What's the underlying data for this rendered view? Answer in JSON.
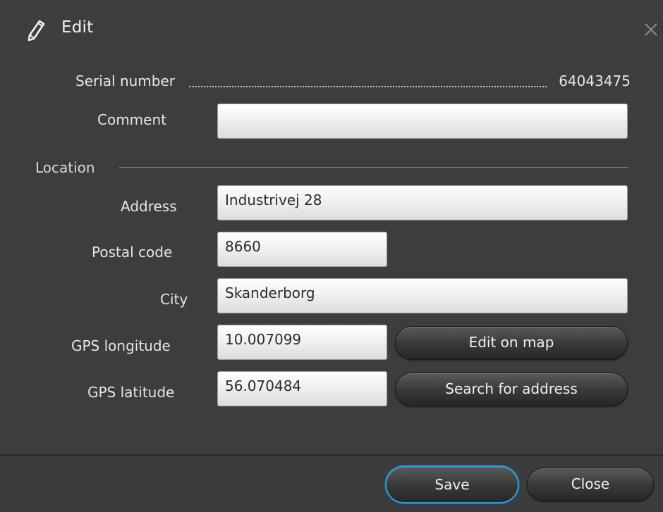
{
  "dialog": {
    "title": "Edit",
    "close_icon": "close-icon",
    "title_icon": "pencil-icon"
  },
  "serial": {
    "label": "Serial number",
    "value": "64043475"
  },
  "comment": {
    "label": "Comment",
    "value": ""
  },
  "location": {
    "section_label": "Location",
    "address": {
      "label": "Address",
      "value": "Industrivej 28"
    },
    "postal_code": {
      "label": "Postal code",
      "value": "8660"
    },
    "city": {
      "label": "City",
      "value": "Skanderborg"
    },
    "gps_longitude": {
      "label": "GPS longitude",
      "value": "10.007099"
    },
    "gps_latitude": {
      "label": "GPS latitude",
      "value": "56.070484"
    },
    "edit_on_map_label": "Edit on map",
    "search_address_label": "Search for address"
  },
  "footer": {
    "save_label": "Save",
    "close_label": "Close"
  },
  "colors": {
    "background": "#3d3d3d",
    "accent_focus": "#2e9ad6",
    "field_bg": "#f0f0f0"
  }
}
